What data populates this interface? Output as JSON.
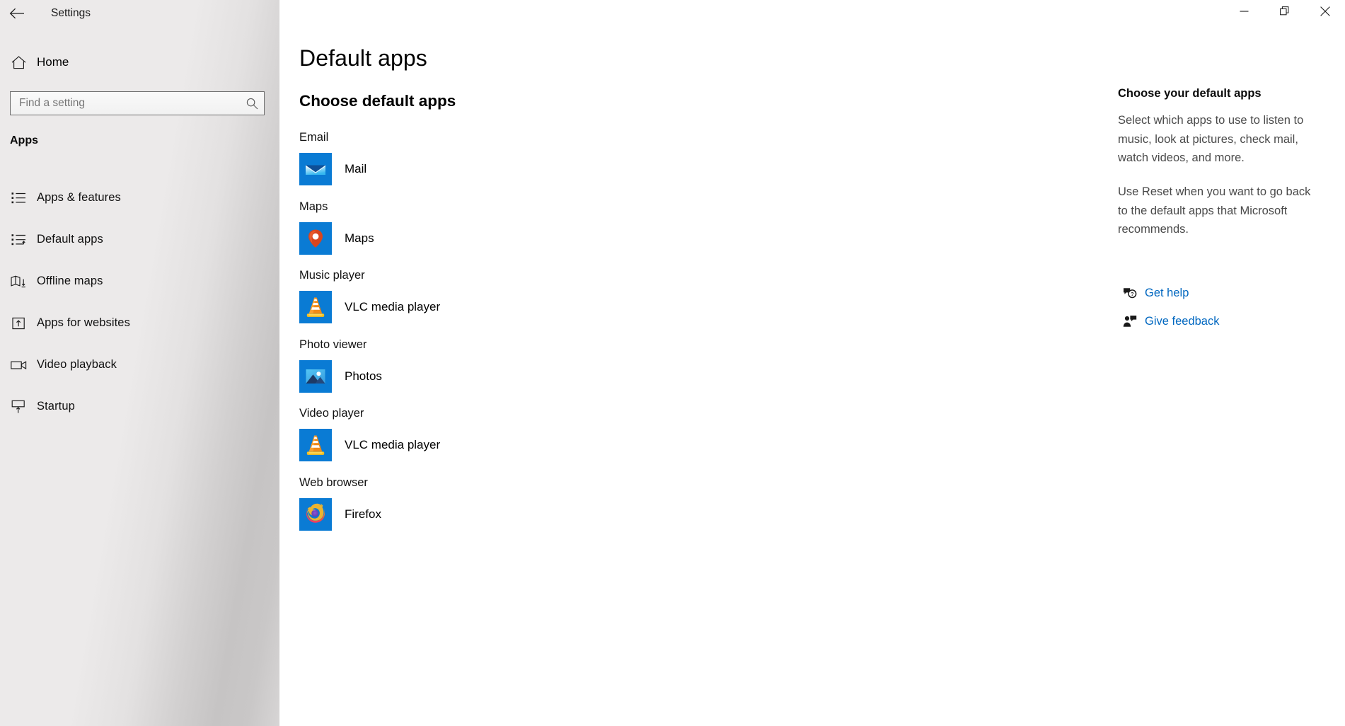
{
  "window": {
    "title": "Settings",
    "back_icon": "back-arrow-icon",
    "controls": {
      "minimize": "minimize-icon",
      "maximize": "restore-icon",
      "close": "close-icon"
    }
  },
  "sidebar": {
    "home": {
      "label": "Home",
      "icon": "home-icon"
    },
    "search": {
      "placeholder": "Find a setting",
      "value": "",
      "icon": "search-icon"
    },
    "category_heading": "Apps",
    "items": [
      {
        "label": "Apps & features",
        "icon": "list-bullets-icon",
        "selected": false
      },
      {
        "label": "Default apps",
        "icon": "list-arrow-icon",
        "selected": true
      },
      {
        "label": "Offline maps",
        "icon": "map-download-icon",
        "selected": false
      },
      {
        "label": "Apps for websites",
        "icon": "box-arrow-up-icon",
        "selected": false
      },
      {
        "label": "Video playback",
        "icon": "video-camera-icon",
        "selected": false
      },
      {
        "label": "Startup",
        "icon": "monitor-arrow-up-icon",
        "selected": false
      }
    ]
  },
  "main": {
    "page_title": "Default apps",
    "section_title": "Choose default apps",
    "groups": [
      {
        "label": "Email",
        "app_name": "Mail",
        "app_icon": "mail-app-icon"
      },
      {
        "label": "Maps",
        "app_name": "Maps",
        "app_icon": "maps-app-icon"
      },
      {
        "label": "Music player",
        "app_name": "VLC media player",
        "app_icon": "vlc-app-icon"
      },
      {
        "label": "Photo viewer",
        "app_name": "Photos",
        "app_icon": "photos-app-icon"
      },
      {
        "label": "Video player",
        "app_name": "VLC media player",
        "app_icon": "vlc-app-icon"
      },
      {
        "label": "Web browser",
        "app_name": "Firefox",
        "app_icon": "firefox-app-icon"
      }
    ]
  },
  "right_panel": {
    "title": "Choose your default apps",
    "paragraph1": "Select which apps to use to listen to music, look at pictures, check mail, watch videos, and more.",
    "paragraph2": "Use Reset when you want to go back to the default apps that Microsoft recommends.",
    "links": [
      {
        "label": "Get help",
        "icon": "help-bubble-icon"
      },
      {
        "label": "Give feedback",
        "icon": "feedback-person-icon"
      }
    ]
  },
  "colors": {
    "accent": "#0067c0",
    "tile_blue": "#0a7bd4",
    "sidebar_bg": "#eceaea",
    "text_primary": "#000000",
    "text_secondary": "#4a4a4a"
  }
}
